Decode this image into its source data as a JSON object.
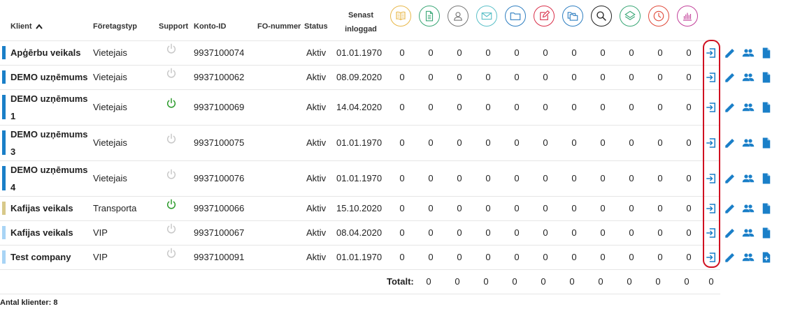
{
  "columns": {
    "client": "Klient",
    "company_type": "Företagstyp",
    "support": "Support",
    "account_id": "Konto-ID",
    "fo_number": "FO-nummer",
    "status": "Status",
    "last_login_line1": "Senast",
    "last_login_line2": "inloggad"
  },
  "module_icons": [
    {
      "name": "book-icon",
      "color": "#e8b84a"
    },
    {
      "name": "document-icon",
      "color": "#3aa776"
    },
    {
      "name": "user-icon",
      "color": "#777777"
    },
    {
      "name": "mail-icon",
      "color": "#5bc0c8"
    },
    {
      "name": "folder-icon",
      "color": "#2f7fc1"
    },
    {
      "name": "edit-icon",
      "color": "#d9304a"
    },
    {
      "name": "folders-icon",
      "color": "#2f7fc1"
    },
    {
      "name": "search-icon",
      "color": "#222222"
    },
    {
      "name": "layers-icon",
      "color": "#3aa776"
    },
    {
      "name": "clock-icon",
      "color": "#e04a3a"
    },
    {
      "name": "chart-icon",
      "color": "#c2409a"
    }
  ],
  "rows": [
    {
      "name_lines": [
        "Apģērbu veikals"
      ],
      "bar_color": "#1a7fc8",
      "type": "Vietejais",
      "support": "off",
      "account_id": "9937100074",
      "fo": "",
      "status": "Aktiv",
      "last_login": "01.01.1970",
      "values": [
        "0",
        "0",
        "0",
        "0",
        "0",
        "0",
        "0",
        "0",
        "0",
        "0",
        "0"
      ],
      "doc_icon": "document-icon"
    },
    {
      "name_lines": [
        "DEMO uzņēmums"
      ],
      "bar_color": "#1a7fc8",
      "type": "Vietejais",
      "support": "off",
      "account_id": "9937100062",
      "fo": "",
      "status": "Aktiv",
      "last_login": "08.09.2020",
      "values": [
        "0",
        "0",
        "0",
        "0",
        "0",
        "0",
        "0",
        "0",
        "0",
        "0",
        "0"
      ],
      "doc_icon": "document-icon"
    },
    {
      "name_lines": [
        "DEMO uzņēmums",
        "1"
      ],
      "bar_color": "#1a7fc8",
      "type": "Vietejais",
      "support": "on",
      "account_id": "9937100069",
      "fo": "",
      "status": "Aktiv",
      "last_login": "14.04.2020",
      "values": [
        "0",
        "0",
        "0",
        "0",
        "0",
        "0",
        "0",
        "0",
        "0",
        "0",
        "0"
      ],
      "doc_icon": "document-icon"
    },
    {
      "name_lines": [
        "DEMO uzņēmums",
        "3"
      ],
      "bar_color": "#1a7fc8",
      "type": "Vietejais",
      "support": "off",
      "account_id": "9937100075",
      "fo": "",
      "status": "Aktiv",
      "last_login": "01.01.1970",
      "values": [
        "0",
        "0",
        "0",
        "0",
        "0",
        "0",
        "0",
        "0",
        "0",
        "0",
        "0"
      ],
      "doc_icon": "document-icon"
    },
    {
      "name_lines": [
        "DEMO uzņēmums",
        "4"
      ],
      "bar_color": "#1a7fc8",
      "type": "Vietejais",
      "support": "off",
      "account_id": "9937100076",
      "fo": "",
      "status": "Aktiv",
      "last_login": "01.01.1970",
      "values": [
        "0",
        "0",
        "0",
        "0",
        "0",
        "0",
        "0",
        "0",
        "0",
        "0",
        "0"
      ],
      "doc_icon": "document-icon"
    },
    {
      "name_lines": [
        "Kafijas veikals"
      ],
      "bar_color": "#d8c98a",
      "type": "Transporta",
      "support": "on",
      "account_id": "9937100066",
      "fo": "",
      "status": "Aktiv",
      "last_login": "15.10.2020",
      "values": [
        "0",
        "0",
        "0",
        "0",
        "0",
        "0",
        "0",
        "0",
        "0",
        "0",
        "0"
      ],
      "doc_icon": "document-icon"
    },
    {
      "name_lines": [
        "Kafijas veikals"
      ],
      "bar_color": "#a8d4f5",
      "type": "VIP",
      "support": "off",
      "account_id": "9937100067",
      "fo": "",
      "status": "Aktiv",
      "last_login": "08.04.2020",
      "values": [
        "0",
        "0",
        "0",
        "0",
        "0",
        "0",
        "0",
        "0",
        "0",
        "0",
        "0"
      ],
      "doc_icon": "document-icon"
    },
    {
      "name_lines": [
        "Test company"
      ],
      "bar_color": "#a8d4f5",
      "type": "VIP",
      "support": "off",
      "account_id": "9937100091",
      "fo": "",
      "status": "Aktiv",
      "last_login": "01.01.1970",
      "values": [
        "0",
        "0",
        "0",
        "0",
        "0",
        "0",
        "0",
        "0",
        "0",
        "0",
        "0"
      ],
      "doc_icon": "document-add-icon"
    }
  ],
  "totals": {
    "label": "Totalt:",
    "values": [
      "0",
      "0",
      "0",
      "0",
      "0",
      "0",
      "0",
      "0",
      "0",
      "0",
      "0"
    ]
  },
  "footer": {
    "count_text": "Antal klienter: 8"
  },
  "actions": [
    "login-icon",
    "pencil-icon",
    "users-icon"
  ],
  "colors": {
    "accent": "#1a7fc8",
    "support_on": "#2a9a2a",
    "support_off": "#c8c8c8",
    "highlight": "#d01020"
  }
}
